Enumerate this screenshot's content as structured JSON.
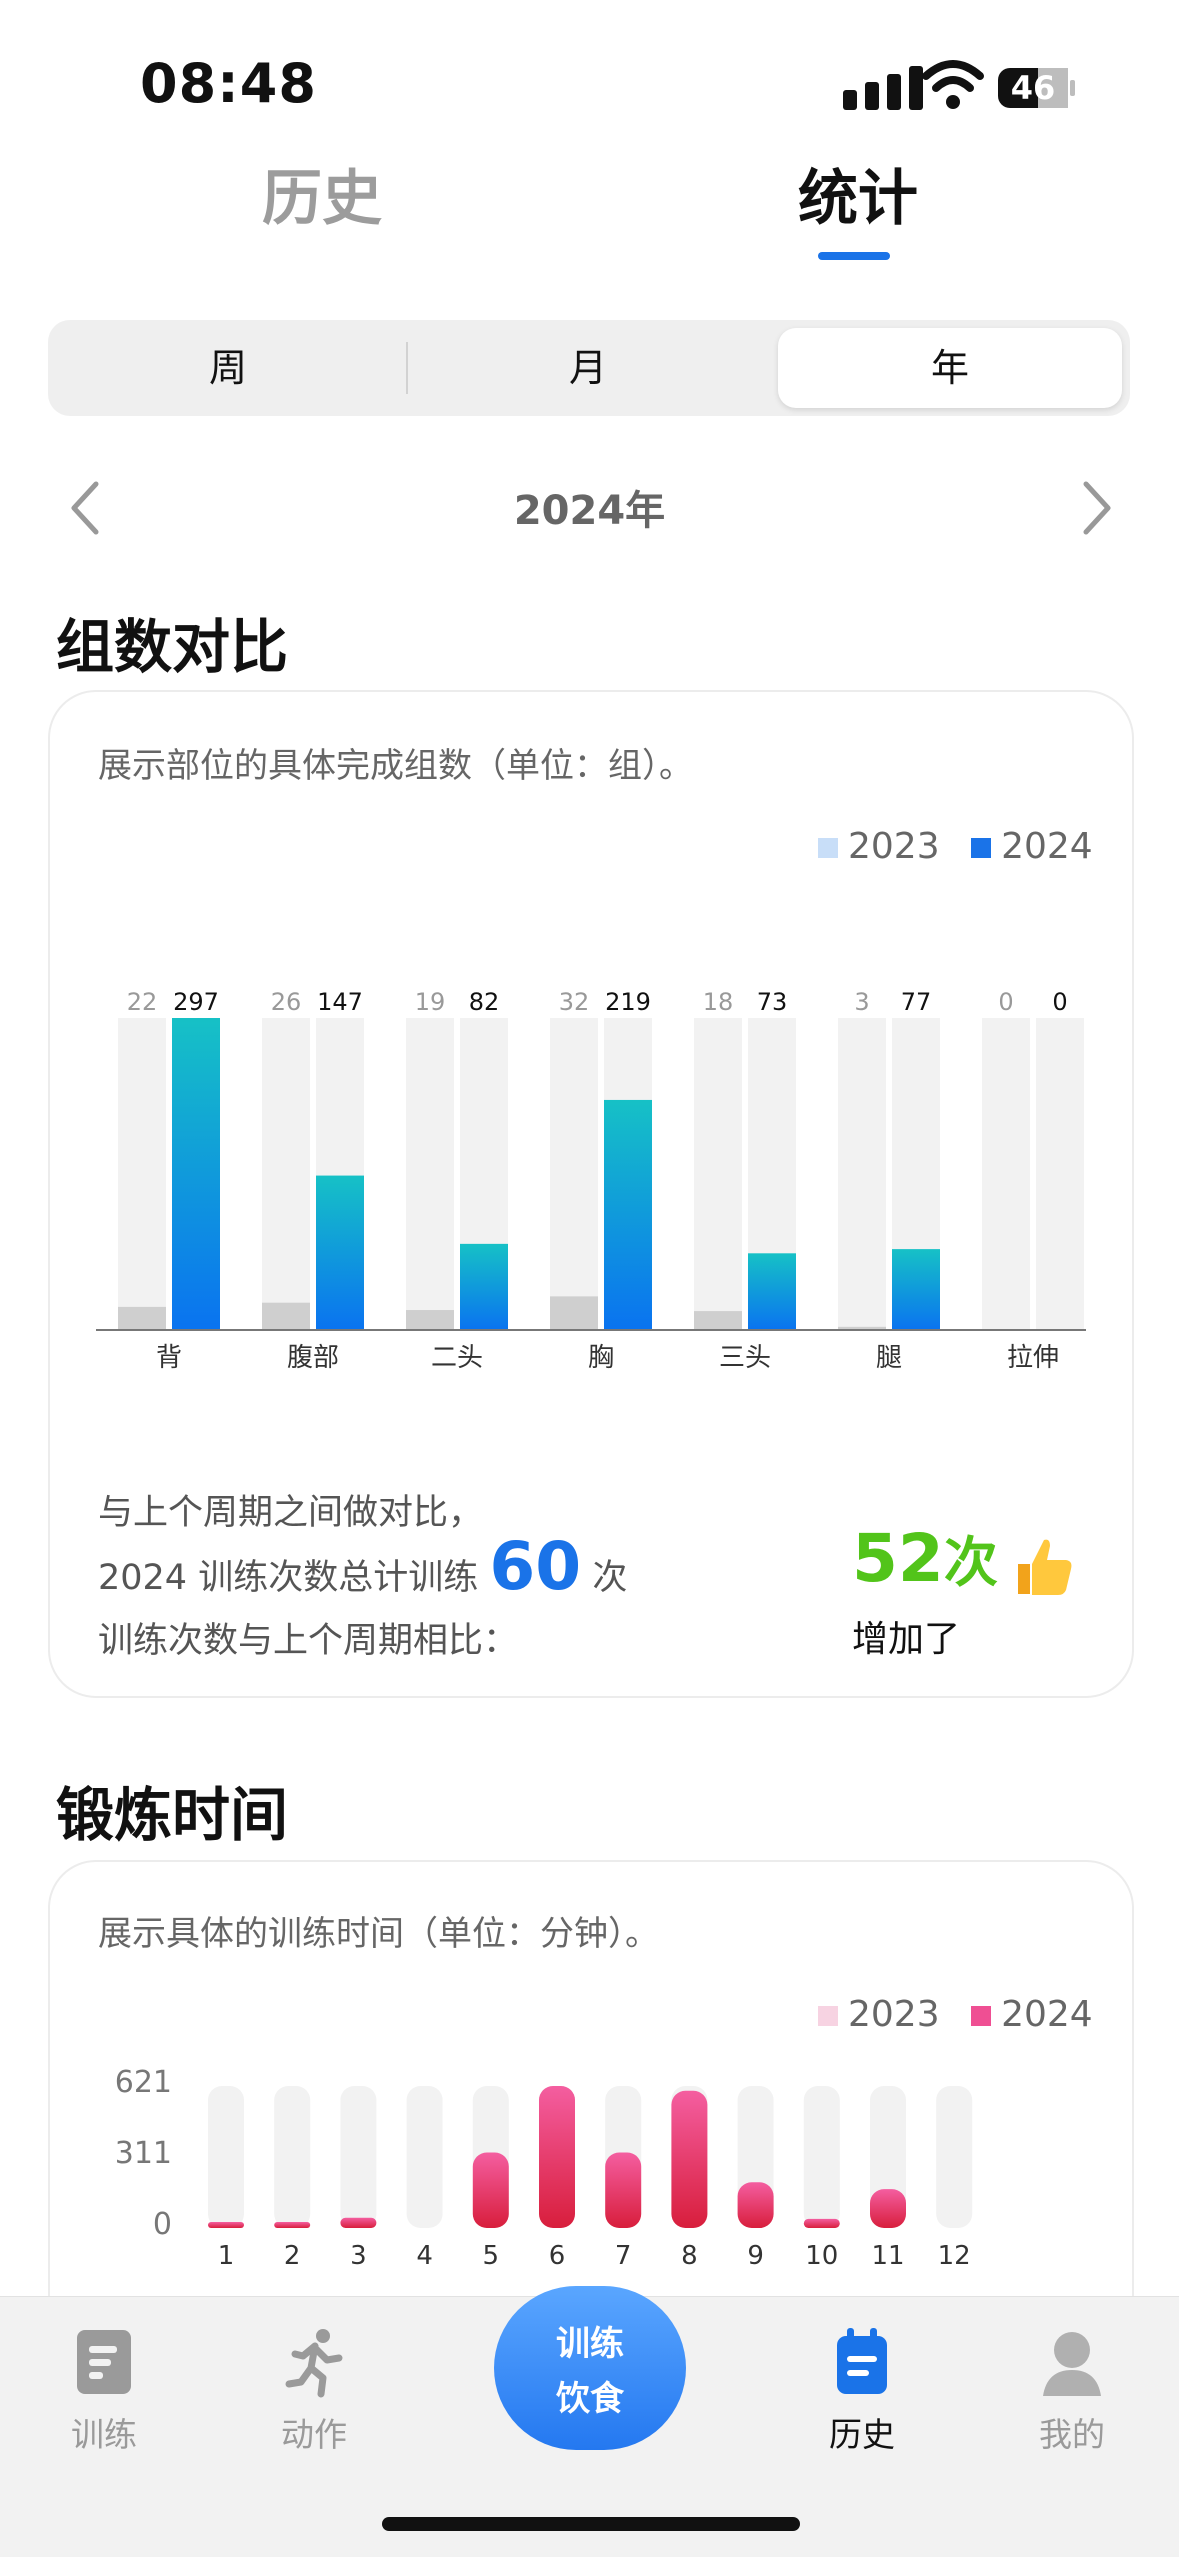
{
  "status_bar": {
    "time": "08:48",
    "battery": "46"
  },
  "top_tabs": {
    "history": "历史",
    "stats": "统计"
  },
  "segment": {
    "week": "周",
    "month": "月",
    "year": "年",
    "selected": "年"
  },
  "period": {
    "label": "2024年"
  },
  "sets_section": {
    "title": "组数对比",
    "description": "展示部位的具体完成组数（单位：组）。",
    "legend": [
      "2023",
      "2024"
    ],
    "colors": {
      "prev": "#cfcfcf",
      "curr_top": "#16c1c6",
      "curr_bottom": "#0a73f0",
      "track": "#f2f2f2",
      "legend_prev": "#c8def8",
      "legend_curr": "#1a73e8"
    },
    "summary_line1": "与上个周期之间做对比，",
    "summary_line2_prefix": "2024 训练次数总计训练",
    "summary_total": "60",
    "summary_line2_suffix": "次",
    "summary_line3": "训练次数与上个周期相比：",
    "delta_value": "52",
    "delta_unit": "次",
    "delta_text": "增加了"
  },
  "time_section": {
    "title": "锻炼时间",
    "description": "展示具体的训练时间（单位：分钟）。",
    "legend": [
      "2023",
      "2024"
    ],
    "colors": {
      "legend_prev": "#f7d3e2",
      "legend_curr": "#ef4f93",
      "bar_top": "#f45ea0",
      "bar_bottom": "#d81e3c",
      "track": "#f2f2f2"
    }
  },
  "chart_data": [
    {
      "type": "bar",
      "categories": [
        "背",
        "腹部",
        "二头",
        "胸",
        "三头",
        "腿",
        "拉伸"
      ],
      "series": [
        {
          "name": "2023",
          "values": [
            22,
            26,
            19,
            32,
            18,
            3,
            0
          ]
        },
        {
          "name": "2024",
          "values": [
            297,
            147,
            82,
            219,
            73,
            77,
            0
          ]
        }
      ],
      "ylim": [
        0,
        297
      ]
    },
    {
      "type": "bar",
      "categories": [
        "1",
        "2",
        "3",
        "4",
        "5",
        "6",
        "7",
        "8",
        "9",
        "10",
        "11",
        "12"
      ],
      "series": [
        {
          "name": "2024",
          "values": [
            20,
            15,
            45,
            0,
            330,
            621,
            330,
            600,
            200,
            40,
            170,
            0
          ]
        }
      ],
      "yticks": [
        "621",
        "311",
        "0"
      ],
      "ylim": [
        0,
        621
      ]
    }
  ],
  "bottom_nav": {
    "items": [
      {
        "label": "训练",
        "icon": "document-icon"
      },
      {
        "label": "动作",
        "icon": "running-figure-icon"
      },
      {
        "label": "历史",
        "icon": "calendar-icon",
        "active": true
      },
      {
        "label": "我的",
        "icon": "user-avatar-icon"
      }
    ],
    "center_line1": "训练",
    "center_line2": "饮食"
  }
}
